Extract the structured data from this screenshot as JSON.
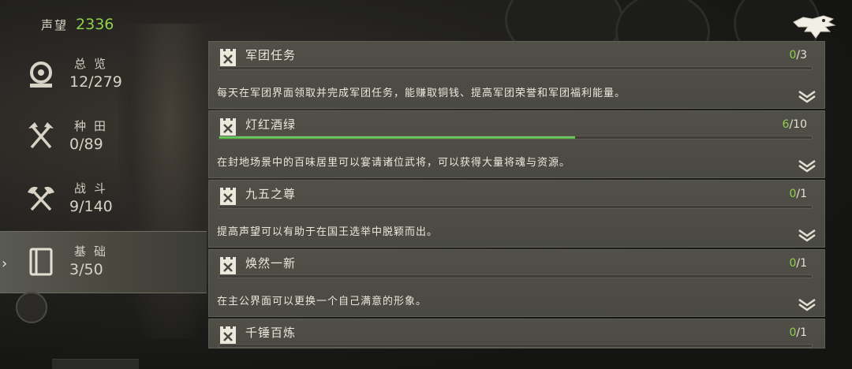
{
  "header": {
    "reputation_label": "声望",
    "reputation_value": "2336"
  },
  "sidebar": {
    "items": [
      {
        "label": "总览",
        "count": "12/279",
        "icon": "overview-icon",
        "active": false
      },
      {
        "label": "种田",
        "count": "0/89",
        "icon": "farming-icon",
        "active": false
      },
      {
        "label": "战斗",
        "count": "9/140",
        "icon": "battle-icon",
        "active": false
      },
      {
        "label": "基础",
        "count": "3/50",
        "icon": "book-icon",
        "active": true
      }
    ]
  },
  "tasks": [
    {
      "title": "军团任务",
      "done": "0",
      "total": "/3",
      "progress": 0.0,
      "desc": "每天在军团界面领取并完成军团任务，能赚取铜钱、提高军团荣誉和军团福利能量。"
    },
    {
      "title": "灯红酒绿",
      "done": "6",
      "total": "/10",
      "progress": 0.6,
      "desc": "在封地场景中的百味居里可以宴请诸位武将，可以获得大量将魂与资源。"
    },
    {
      "title": "九五之尊",
      "done": "0",
      "total": "/1",
      "progress": 0.0,
      "desc": "提高声望可以有助于在国王选举中脱颖而出。"
    },
    {
      "title": "焕然一新",
      "done": "0",
      "total": "/1",
      "progress": 0.0,
      "desc": "在主公界面可以更换一个自己满意的形象。"
    },
    {
      "title": "千锤百炼",
      "done": "0",
      "total": "/1",
      "progress": 0.0,
      "desc": ""
    }
  ],
  "colors": {
    "accent_green": "#8fcf4d",
    "bar_fill": "#5fc24f",
    "card_bg": "#4d4c46"
  }
}
